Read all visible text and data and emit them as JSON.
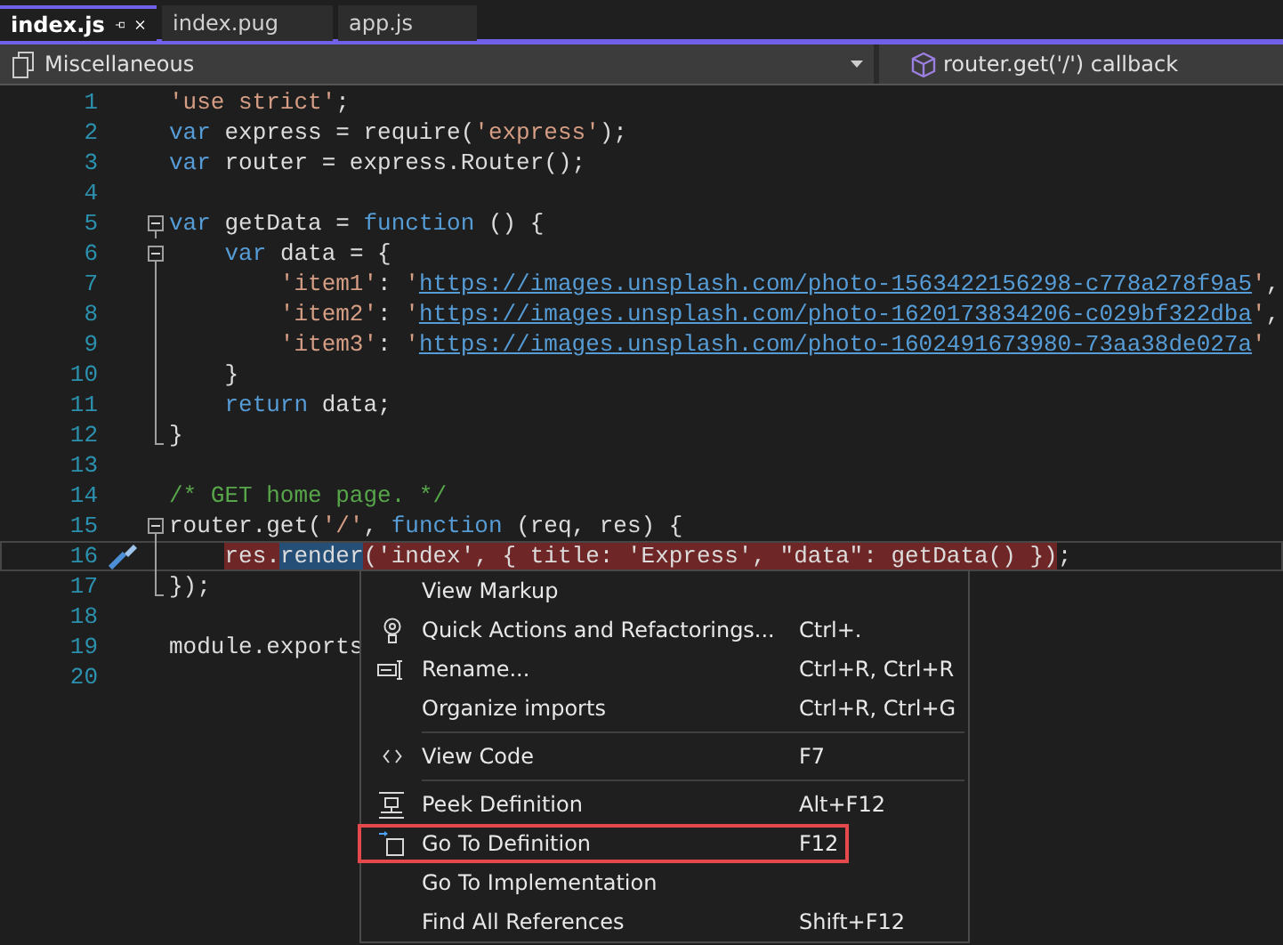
{
  "tabs": [
    {
      "label": "index.js",
      "selected": true,
      "pinned": true
    },
    {
      "label": "index.pug",
      "selected": false,
      "pinned": false
    },
    {
      "label": "app.js",
      "selected": false,
      "pinned": false
    }
  ],
  "navigation_bar": {
    "project": "Miscellaneous",
    "member": "router.get('/') callback"
  },
  "editor": {
    "lines": [
      {
        "number": "1",
        "tokens": [
          {
            "kind": "string",
            "text": "'use strict'"
          },
          {
            "kind": "plain",
            "text": ";"
          }
        ]
      },
      {
        "number": "2",
        "tokens": [
          {
            "kind": "keyword",
            "text": "var"
          },
          {
            "kind": "plain",
            "text": " express = require("
          },
          {
            "kind": "string",
            "text": "'express'"
          },
          {
            "kind": "plain",
            "text": ");"
          }
        ]
      },
      {
        "number": "3",
        "tokens": [
          {
            "kind": "keyword",
            "text": "var"
          },
          {
            "kind": "plain",
            "text": " router = express.Router();"
          }
        ]
      },
      {
        "number": "4"
      },
      {
        "number": "5",
        "collapsible": true,
        "tokens": [
          {
            "kind": "keyword",
            "text": "var"
          },
          {
            "kind": "plain",
            "text": " getData = "
          },
          {
            "kind": "keyword",
            "text": "function"
          },
          {
            "kind": "plain",
            "text": " () {"
          }
        ]
      },
      {
        "number": "6",
        "collapsible": true,
        "tokens": [
          {
            "kind": "keyword",
            "text": "    var"
          },
          {
            "kind": "plain",
            "text": " data = {"
          }
        ]
      },
      {
        "number": "7",
        "in_block": true,
        "tokens": [
          {
            "kind": "string",
            "text": "        'item1'"
          },
          {
            "kind": "plain",
            "text": ": "
          },
          {
            "kind": "string",
            "text": "'"
          },
          {
            "kind": "link",
            "text": "https://images.unsplash.com/photo-1563422156298-c778a278f9a5"
          },
          {
            "kind": "string",
            "text": "'"
          },
          {
            "kind": "plain",
            "text": ","
          }
        ]
      },
      {
        "number": "8",
        "in_block": true,
        "tokens": [
          {
            "kind": "string",
            "text": "        'item2'"
          },
          {
            "kind": "plain",
            "text": ": "
          },
          {
            "kind": "string",
            "text": "'"
          },
          {
            "kind": "link",
            "text": "https://images.unsplash.com/photo-1620173834206-c029bf322dba"
          },
          {
            "kind": "string",
            "text": "'"
          },
          {
            "kind": "plain",
            "text": ","
          }
        ]
      },
      {
        "number": "9",
        "in_block": true,
        "tokens": [
          {
            "kind": "string",
            "text": "        'item3'"
          },
          {
            "kind": "plain",
            "text": ": "
          },
          {
            "kind": "string",
            "text": "'"
          },
          {
            "kind": "link",
            "text": "https://images.unsplash.com/photo-1602491673980-73aa38de027a"
          },
          {
            "kind": "string",
            "text": "'"
          }
        ]
      },
      {
        "number": "10",
        "in_block": true,
        "tokens": [
          {
            "kind": "plain",
            "text": "    }"
          }
        ]
      },
      {
        "number": "11",
        "in_block": true,
        "tokens": [
          {
            "kind": "keyword",
            "text": "    return"
          },
          {
            "kind": "plain",
            "text": " data;"
          }
        ]
      },
      {
        "number": "12",
        "in_block": true,
        "block_end": true,
        "tokens": [
          {
            "kind": "plain",
            "text": "}"
          }
        ]
      },
      {
        "number": "13"
      },
      {
        "number": "14",
        "tokens": [
          {
            "kind": "comment",
            "text": "/* GET home page. */"
          }
        ]
      },
      {
        "number": "15",
        "collapsible": true,
        "tokens": [
          {
            "kind": "plain",
            "text": "router.get("
          },
          {
            "kind": "string",
            "text": "'/'"
          },
          {
            "kind": "plain",
            "text": ", "
          },
          {
            "kind": "keyword",
            "text": "function"
          },
          {
            "kind": "plain",
            "text": " (req, res) {"
          }
        ]
      },
      {
        "number": "16",
        "in_block": true,
        "current": true,
        "quick_action": true,
        "tokens": [
          {
            "kind": "plain",
            "text": "    res.",
            "error": true
          },
          {
            "kind": "plain",
            "text": "render",
            "selected": true
          },
          {
            "kind": "plain",
            "text": "('index', { title: 'Express', \"data\": getData() })",
            "error": true
          },
          {
            "kind": "plain",
            "text": ";"
          }
        ]
      },
      {
        "number": "17",
        "in_block": true,
        "block_end": true,
        "tokens": [
          {
            "kind": "plain",
            "text": "});"
          }
        ]
      },
      {
        "number": "18"
      },
      {
        "number": "19",
        "tokens": [
          {
            "kind": "plain",
            "text": "module.exports"
          }
        ]
      },
      {
        "number": "20"
      }
    ]
  },
  "context_menu": {
    "items": [
      {
        "kind": "item",
        "label": "View Markup"
      },
      {
        "kind": "item",
        "label": "Quick Actions and Refactorings...",
        "shortcut": "Ctrl+."
      },
      {
        "kind": "item",
        "label": "Rename...",
        "shortcut": "Ctrl+R, Ctrl+R"
      },
      {
        "kind": "item",
        "label": "Organize imports",
        "shortcut": "Ctrl+R, Ctrl+G"
      },
      {
        "kind": "separator"
      },
      {
        "kind": "item",
        "label": "View Code",
        "shortcut": "F7"
      },
      {
        "kind": "separator"
      },
      {
        "kind": "item",
        "label": "Peek Definition",
        "shortcut": "Alt+F12"
      },
      {
        "kind": "item",
        "label": "Go To Definition",
        "shortcut": "F12",
        "outlined": true
      },
      {
        "kind": "item",
        "label": "Go To Implementation"
      },
      {
        "kind": "item",
        "label": "Find All References",
        "shortcut": "Shift+F12"
      }
    ]
  }
}
